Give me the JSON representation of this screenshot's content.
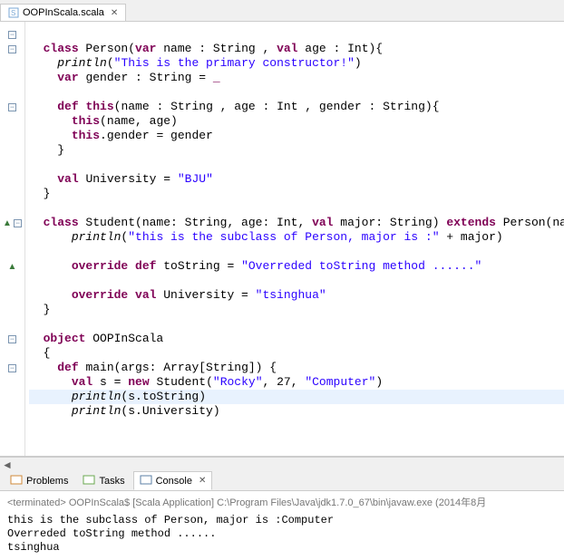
{
  "editor": {
    "tab": {
      "label": "OOPInScala.scala"
    },
    "lines": [
      {
        "indent": 0,
        "ruler": "minus",
        "segs": []
      },
      {
        "indent": 1,
        "ruler": "minus",
        "segs": [
          {
            "t": "class ",
            "c": "kw"
          },
          {
            "t": "Person(",
            "c": ""
          },
          {
            "t": "var ",
            "c": "kw"
          },
          {
            "t": "name : String , ",
            "c": ""
          },
          {
            "t": "val ",
            "c": "kw"
          },
          {
            "t": "age : Int){",
            "c": ""
          }
        ]
      },
      {
        "indent": 2,
        "ruler": "",
        "segs": [
          {
            "t": "println",
            "c": "mtd"
          },
          {
            "t": "(",
            "c": ""
          },
          {
            "t": "\"This is the primary constructor!\"",
            "c": "str"
          },
          {
            "t": ")",
            "c": ""
          }
        ]
      },
      {
        "indent": 2,
        "ruler": "",
        "segs": [
          {
            "t": "var ",
            "c": "kw"
          },
          {
            "t": "gender : String = ",
            "c": ""
          },
          {
            "t": "_",
            "c": "kw"
          }
        ]
      },
      {
        "indent": 0,
        "ruler": "",
        "segs": []
      },
      {
        "indent": 2,
        "ruler": "minus",
        "segs": [
          {
            "t": "def ",
            "c": "kw"
          },
          {
            "t": "this",
            "c": "kw"
          },
          {
            "t": "(name : String , age : Int , gender : String){",
            "c": ""
          }
        ]
      },
      {
        "indent": 3,
        "ruler": "",
        "segs": [
          {
            "t": "this",
            "c": "kw"
          },
          {
            "t": "(name, age)",
            "c": ""
          }
        ]
      },
      {
        "indent": 3,
        "ruler": "",
        "segs": [
          {
            "t": "this",
            "c": "kw"
          },
          {
            "t": ".gender = gender",
            "c": ""
          }
        ]
      },
      {
        "indent": 2,
        "ruler": "",
        "segs": [
          {
            "t": "}",
            "c": ""
          }
        ]
      },
      {
        "indent": 0,
        "ruler": "",
        "segs": []
      },
      {
        "indent": 2,
        "ruler": "",
        "segs": [
          {
            "t": "val ",
            "c": "kw"
          },
          {
            "t": "University = ",
            "c": ""
          },
          {
            "t": "\"BJU\"",
            "c": "str"
          }
        ]
      },
      {
        "indent": 1,
        "ruler": "",
        "segs": [
          {
            "t": "}",
            "c": ""
          }
        ]
      },
      {
        "indent": 0,
        "ruler": "",
        "segs": []
      },
      {
        "indent": 1,
        "ruler": "tri-minus",
        "segs": [
          {
            "t": "class ",
            "c": "kw"
          },
          {
            "t": "Student(name: String, age: Int, ",
            "c": ""
          },
          {
            "t": "val ",
            "c": "kw"
          },
          {
            "t": "major: String) ",
            "c": ""
          },
          {
            "t": "extends ",
            "c": "kw"
          },
          {
            "t": "Person(name, age){",
            "c": ""
          }
        ]
      },
      {
        "indent": 3,
        "ruler": "",
        "segs": [
          {
            "t": "println",
            "c": "mtd"
          },
          {
            "t": "(",
            "c": ""
          },
          {
            "t": "\"this is the subclass of Person, major is :\"",
            "c": "str"
          },
          {
            "t": " + major)",
            "c": ""
          }
        ]
      },
      {
        "indent": 0,
        "ruler": "",
        "segs": []
      },
      {
        "indent": 3,
        "ruler": "tri",
        "segs": [
          {
            "t": "override def ",
            "c": "kw"
          },
          {
            "t": "toString = ",
            "c": ""
          },
          {
            "t": "\"Overreded toString method ......\"",
            "c": "str"
          }
        ]
      },
      {
        "indent": 0,
        "ruler": "",
        "segs": []
      },
      {
        "indent": 3,
        "ruler": "",
        "segs": [
          {
            "t": "override val ",
            "c": "kw"
          },
          {
            "t": "University = ",
            "c": ""
          },
          {
            "t": "\"tsinghua\"",
            "c": "str"
          }
        ]
      },
      {
        "indent": 1,
        "ruler": "",
        "segs": [
          {
            "t": "}",
            "c": ""
          }
        ]
      },
      {
        "indent": 0,
        "ruler": "",
        "segs": []
      },
      {
        "indent": 1,
        "ruler": "minus",
        "segs": [
          {
            "t": "object ",
            "c": "kw"
          },
          {
            "t": "OOPInScala",
            "c": ""
          }
        ]
      },
      {
        "indent": 1,
        "ruler": "",
        "segs": [
          {
            "t": "{",
            "c": ""
          }
        ]
      },
      {
        "indent": 2,
        "ruler": "minus",
        "segs": [
          {
            "t": "def ",
            "c": "kw"
          },
          {
            "t": "main(args: Array[String]) {",
            "c": ""
          }
        ]
      },
      {
        "indent": 3,
        "ruler": "",
        "segs": [
          {
            "t": "val ",
            "c": "kw"
          },
          {
            "t": "s = ",
            "c": ""
          },
          {
            "t": "new ",
            "c": "kw"
          },
          {
            "t": "Student(",
            "c": ""
          },
          {
            "t": "\"Rocky\"",
            "c": "str"
          },
          {
            "t": ", 27, ",
            "c": ""
          },
          {
            "t": "\"Computer\"",
            "c": "str"
          },
          {
            "t": ")",
            "c": ""
          }
        ]
      },
      {
        "indent": 3,
        "ruler": "",
        "hl": true,
        "segs": [
          {
            "t": "println",
            "c": "mtd"
          },
          {
            "t": "(s.toString)",
            "c": ""
          }
        ]
      },
      {
        "indent": 3,
        "ruler": "",
        "segs": [
          {
            "t": "println",
            "c": "mtd"
          },
          {
            "t": "(s.University)",
            "c": ""
          }
        ]
      }
    ]
  },
  "bottom": {
    "tabs": [
      {
        "label": "Problems",
        "icon": "problems-icon"
      },
      {
        "label": "Tasks",
        "icon": "tasks-icon"
      },
      {
        "label": "Console",
        "icon": "console-icon",
        "active": true
      }
    ]
  },
  "console": {
    "header": "<terminated> OOPInScala$ [Scala Application] C:\\Program Files\\Java\\jdk1.7.0_67\\bin\\javaw.exe (2014年8月",
    "lines": [
      "this is the subclass of Person, major is :Computer",
      "Overreded toString method ......",
      "tsinghua"
    ]
  }
}
